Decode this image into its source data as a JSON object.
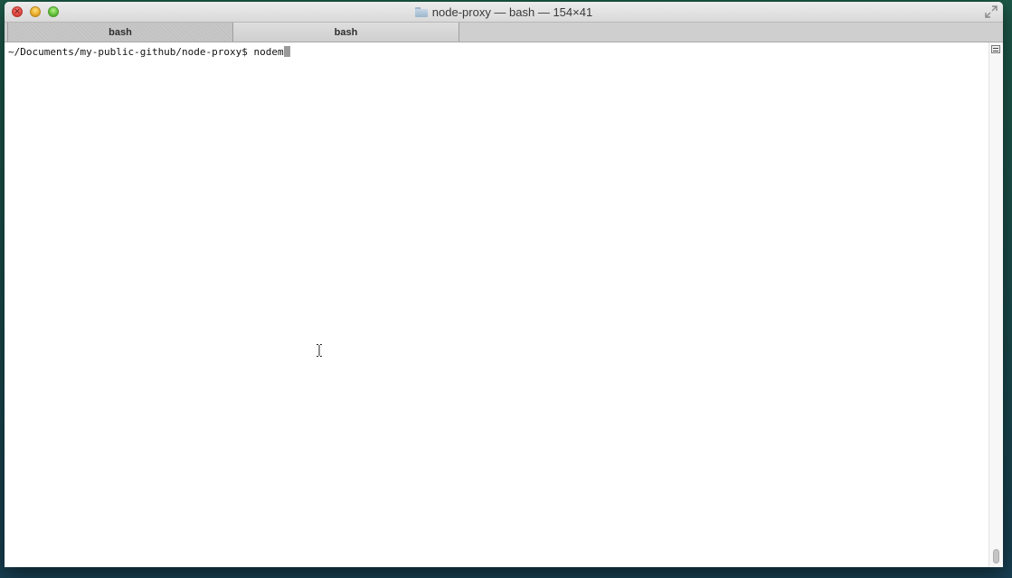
{
  "window": {
    "title": "node-proxy — bash — 154×41",
    "controls": {
      "close_icon": "close-icon",
      "minimize_icon": "minimize-icon",
      "zoom_icon": "zoom-icon",
      "fullscreen_icon": "fullscreen-icon"
    },
    "title_icon": "folder-icon"
  },
  "tabs": [
    {
      "label": "bash",
      "active": true
    },
    {
      "label": "bash",
      "active": false
    }
  ],
  "terminal": {
    "prompt": "~/Documents/my-public-github/node-proxy$ ",
    "command": "nodem"
  },
  "colors": {
    "terminal_background": "#ffffff",
    "terminal_text": "#111111",
    "cursor": "#9a9a9a",
    "desktop": "#1a4f4a"
  }
}
